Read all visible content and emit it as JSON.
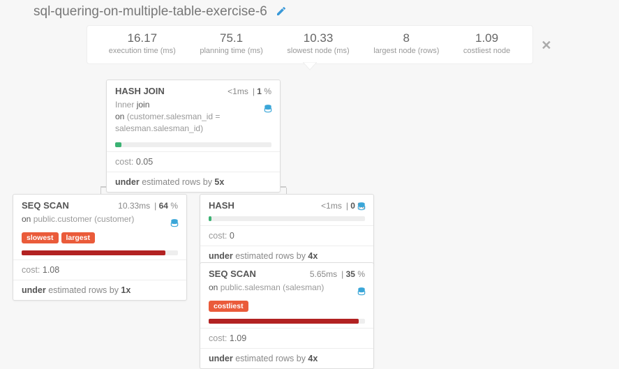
{
  "page": {
    "title": "sql-quering-on-multiple-table-exercise-6"
  },
  "stats": {
    "exec": {
      "val": "16.17",
      "lbl": "execution time (ms)"
    },
    "plan": {
      "val": "75.1",
      "lbl": "planning time (ms)"
    },
    "slow": {
      "val": "10.33",
      "lbl": "slowest node (ms)"
    },
    "large": {
      "val": "8",
      "lbl": "largest node (rows)"
    },
    "cost": {
      "val": "1.09",
      "lbl": "costliest node"
    }
  },
  "node_hashjoin": {
    "name": "HASH JOIN",
    "time": "<1ms",
    "pct": "1",
    "detail_pre": "Inner ",
    "detail_join": "join",
    "detail_on_kw": "on",
    "detail_on": " (customer.salesman_id = salesman.salesman_id)",
    "bar_color": "#3bb273",
    "bar_pct": 4,
    "cost_lbl": "cost: ",
    "cost": "0.05",
    "est_kw": "under",
    "est_txt": " estimated rows by ",
    "est_x": "5x"
  },
  "node_scan_customer": {
    "name": "SEQ SCAN",
    "time": "10.33ms",
    "pct": "64",
    "detail_on_kw": "on",
    "detail": " public.customer (customer)",
    "badges": {
      "a": "slowest",
      "b": "largest"
    },
    "bar_color": "#b22222",
    "bar_pct": 92,
    "cost_lbl": "cost: ",
    "cost": "1.08",
    "est_kw": "under",
    "est_txt": " estimated rows by ",
    "est_x": "1x"
  },
  "node_hash": {
    "name": "HASH",
    "time": "<1ms",
    "pct": "0",
    "bar_color": "#3bb273",
    "bar_pct": 2,
    "cost_lbl": "cost: ",
    "cost": "0",
    "est_kw": "under",
    "est_txt": " estimated rows by ",
    "est_x": "4x"
  },
  "node_scan_salesman": {
    "name": "SEQ SCAN",
    "time": "5.65ms",
    "pct": "35",
    "detail_on_kw": "on",
    "detail": " public.salesman (salesman)",
    "badges": {
      "a": "costliest"
    },
    "bar_color": "#b22222",
    "bar_pct": 96,
    "cost_lbl": "cost: ",
    "cost": "1.09",
    "est_kw": "under",
    "est_txt": " estimated rows by ",
    "est_x": "4x"
  }
}
